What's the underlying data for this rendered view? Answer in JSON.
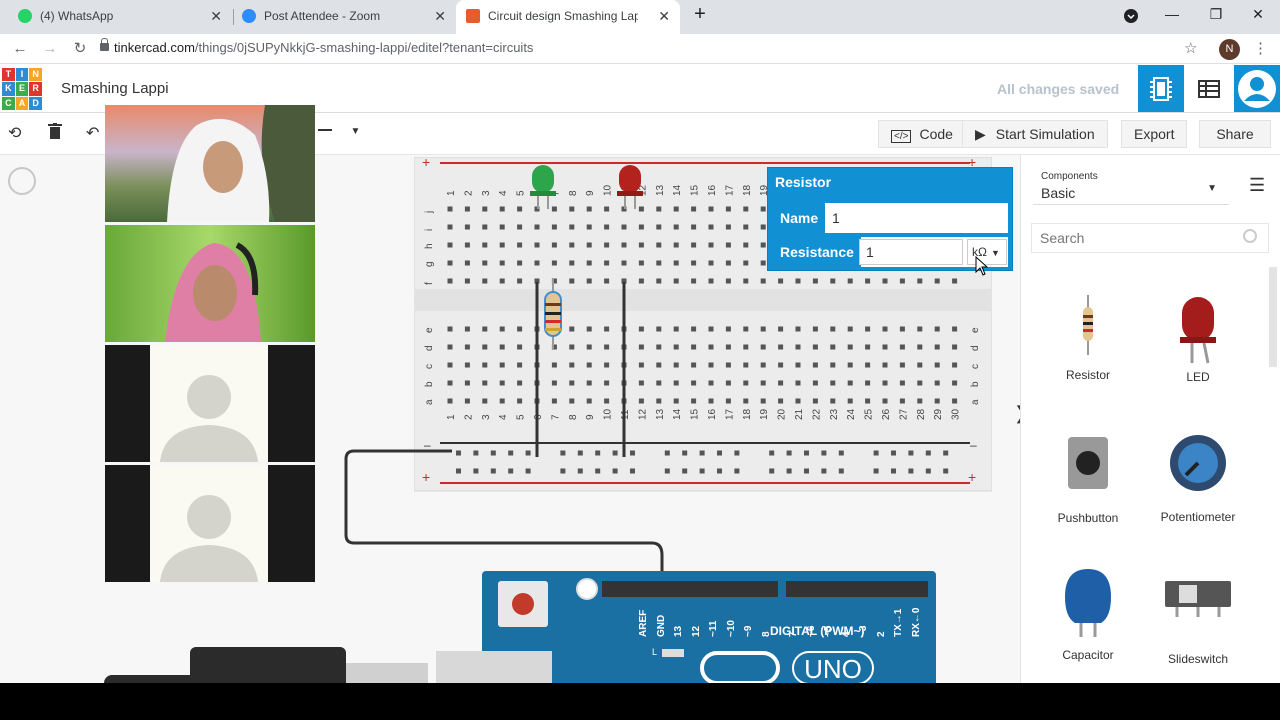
{
  "tabs": [
    {
      "label": "(4) WhatsApp",
      "color": "#25d366"
    },
    {
      "label": "Post Attendee - Zoom",
      "color": "#2d8cff"
    },
    {
      "label": "Circuit design Smashing Lappi | T",
      "color": "#e45d2b"
    }
  ],
  "address": {
    "host": "tinkercad.com",
    "path": "/things/0jSUPyNkkjG-smashing-lappi/editel?tenant=circuits"
  },
  "profile_initial": "N",
  "header": {
    "logo_letters": [
      "T",
      "I",
      "N",
      "K",
      "E",
      "R",
      "C",
      "A",
      "D"
    ],
    "project_title": "Smashing Lappi",
    "save_status": "All changes saved"
  },
  "toolbar": {
    "code_label": "Code",
    "code_icon": "</>",
    "start_label": "Start Simulation",
    "export_label": "Export",
    "share_label": "Share"
  },
  "breadboard": {
    "top_numbers": [
      "1",
      "2",
      "3",
      "4",
      "5",
      "6",
      "7",
      "8",
      "9",
      "10",
      "11",
      "12",
      "13",
      "14",
      "15",
      "16",
      "17",
      "18",
      "19",
      "20",
      "21",
      "22",
      "23",
      "24",
      "25",
      "26",
      "27",
      "28",
      "29",
      "30"
    ],
    "upper_rows": [
      "j",
      "i",
      "h",
      "g",
      "f"
    ],
    "lower_rows": [
      "e",
      "d",
      "c",
      "b",
      "a"
    ],
    "plus": "+",
    "minus": "–"
  },
  "inspector": {
    "title": "Resistor",
    "name_label": "Name",
    "name_value": "1",
    "resistance_label": "Resistance",
    "resistance_value": "1",
    "unit": "kΩ"
  },
  "components": {
    "dropdown_caption": "Components",
    "dropdown_value": "Basic",
    "search_placeholder": "Search",
    "items": [
      "Resistor",
      "LED",
      "Pushbutton",
      "Potentiometer",
      "Capacitor",
      "Slideswitch"
    ]
  },
  "arduino": {
    "digital_label": "DIGITAL (PWM~)",
    "uno_label": "UNO",
    "pins": [
      "AREF",
      "GND",
      "13",
      "12",
      "~11",
      "~10",
      "~9",
      "8",
      "7",
      "~6",
      "~5",
      "4",
      "~3",
      "2",
      "TX→1",
      "RX←0"
    ],
    "l_label": "L"
  },
  "expand_arrow": "❯"
}
